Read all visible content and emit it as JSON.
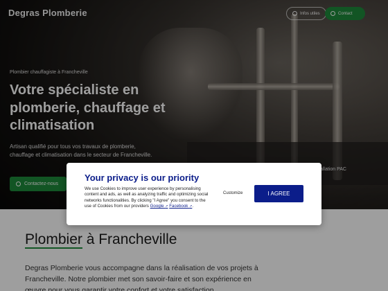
{
  "header": {
    "logo": "Degras Plomberie",
    "btn_outline": "Infos utiles",
    "btn_green": "Contact"
  },
  "hero": {
    "eyebrow": "Plombier chauffagiste à Francheville",
    "headline": "Votre spécialiste en plomberie, chauffage et climatisation",
    "description": "Artisan qualifié pour tous vos travaux de plomberie, chauffage et climatisation dans le secteur de Francheville.",
    "cta": "Contactez-nous",
    "card_label": "Installation PAC"
  },
  "section": {
    "title_part1": "Plombier",
    "title_part2": " à Francheville",
    "body": "Degras Plomberie vous accompagne dans la réalisation de vos projets à Francheville. Notre plombier met son savoir-faire et son expérience en œuvre pour vous garantir votre confort et votre satisfaction."
  },
  "consent": {
    "title": "Your privacy is our priority",
    "text": "We use Cookies to improve user experience by personalising content and ads, as well as analyzing traffic and optimizing social networks functionalities. By clicking \"I Agree\" you consent to the use of Cookies from our providers",
    "link_google": "Google",
    "link_facebook": "Facebook",
    "customize": "Customize",
    "agree": "I AGREE"
  },
  "colors": {
    "brand_green": "#1e8a3a",
    "consent_blue": "#0b1d8a"
  },
  "icons": [
    "info-icon",
    "phone-icon",
    "external-link-icon"
  ]
}
